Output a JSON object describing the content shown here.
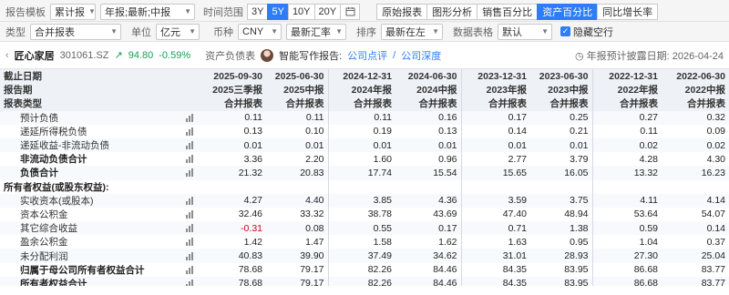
{
  "toolbar1": {
    "report_template_label": "报告模板",
    "template_value": "累计报",
    "period_value": "年报;最新;中报",
    "time_range_label": "时间范围",
    "ranges": [
      "3Y",
      "5Y",
      "10Y",
      "20Y"
    ],
    "active_range": "5Y",
    "tabs": [
      "原始报表",
      "图形分析",
      "销售百分比",
      "资产百分比",
      "同比增长率"
    ],
    "active_tab": "资产百分比"
  },
  "toolbar2": {
    "type_label": "类型",
    "type_value": "合并报表",
    "unit_label": "单位",
    "unit_value": "亿元",
    "currency_label": "币种",
    "currency_value": "CNY",
    "rate_value": "最新汇率",
    "sort_label": "排序",
    "sort_value": "最新在左",
    "data_table_label": "数据表格",
    "data_table_value": "默认",
    "hide_empty_label": "隐藏空行"
  },
  "stock": {
    "name": "匠心家居",
    "code": "301061.SZ",
    "price": "94.80",
    "change": "-0.59%",
    "section": "资产负债表",
    "smart_report_label": "智能写作报告:",
    "link1": "公司点评",
    "link_sep": "/",
    "link2": "公司深度",
    "annual_disclosure": "年报预计披露日期: 2026-04-24"
  },
  "table": {
    "header_rows": [
      [
        "截止日期",
        "2025-09-30",
        "2025-06-30",
        "2024-12-31",
        "2024-06-30",
        "2023-12-31",
        "2023-06-30",
        "2022-12-31",
        "2022-06-30"
      ],
      [
        "报告期",
        "2025三季报",
        "2025中报",
        "2024年报",
        "2024中报",
        "2023年报",
        "2023中报",
        "2022年报",
        "2022中报"
      ],
      [
        "报表类型",
        "合并报表",
        "合并报表",
        "合并报表",
        "合并报表",
        "合并报表",
        "合并报表",
        "合并报表",
        "合并报表"
      ]
    ],
    "rows": [
      {
        "label": "预计负债",
        "indent": true,
        "bold": false,
        "chart": true,
        "values": [
          "0.11",
          "0.11",
          "0.11",
          "0.16",
          "0.17",
          "0.25",
          "0.27",
          "0.32"
        ]
      },
      {
        "label": "递延所得税负债",
        "indent": true,
        "bold": false,
        "chart": true,
        "values": [
          "0.13",
          "0.10",
          "0.19",
          "0.13",
          "0.14",
          "0.21",
          "0.11",
          "0.09"
        ]
      },
      {
        "label": "递延收益-非流动负债",
        "indent": true,
        "bold": false,
        "chart": true,
        "values": [
          "0.01",
          "0.01",
          "0.01",
          "0.01",
          "0.01",
          "0.01",
          "0.02",
          "0.02"
        ]
      },
      {
        "label": "非流动负债合计",
        "indent": true,
        "bold": true,
        "chart": true,
        "values": [
          "3.36",
          "2.20",
          "1.60",
          "0.96",
          "2.77",
          "3.79",
          "4.28",
          "4.30"
        ]
      },
      {
        "label": "负债合计",
        "indent": true,
        "bold": true,
        "chart": true,
        "values": [
          "21.32",
          "20.83",
          "17.74",
          "15.54",
          "15.65",
          "16.05",
          "13.32",
          "16.23"
        ]
      },
      {
        "label": "所有者权益(或股东权益):",
        "indent": false,
        "bold": true,
        "chart": false,
        "values": [
          "",
          "",
          "",
          "",
          "",
          "",
          "",
          ""
        ]
      },
      {
        "label": "实收资本(或股本)",
        "indent": true,
        "bold": false,
        "chart": true,
        "values": [
          "4.27",
          "4.40",
          "3.85",
          "4.36",
          "3.59",
          "3.75",
          "4.11",
          "4.14"
        ]
      },
      {
        "label": "资本公积金",
        "indent": true,
        "bold": false,
        "chart": true,
        "values": [
          "32.46",
          "33.32",
          "38.78",
          "43.69",
          "47.40",
          "48.94",
          "53.64",
          "54.07"
        ]
      },
      {
        "label": "其它综合收益",
        "indent": true,
        "bold": false,
        "chart": true,
        "values": [
          "-0.31",
          "0.08",
          "0.55",
          "0.17",
          "0.71",
          "1.38",
          "0.59",
          "0.14"
        ]
      },
      {
        "label": "盈余公积金",
        "indent": true,
        "bold": false,
        "chart": true,
        "values": [
          "1.42",
          "1.47",
          "1.58",
          "1.62",
          "1.63",
          "0.95",
          "1.04",
          "0.37"
        ]
      },
      {
        "label": "未分配利润",
        "indent": true,
        "bold": false,
        "chart": true,
        "values": [
          "40.83",
          "39.90",
          "37.49",
          "34.62",
          "31.01",
          "28.93",
          "27.30",
          "25.04"
        ]
      },
      {
        "label": "归属于母公司所有者权益合计",
        "indent": true,
        "bold": true,
        "chart": true,
        "values": [
          "78.68",
          "79.17",
          "82.26",
          "84.46",
          "84.35",
          "83.95",
          "86.68",
          "83.77"
        ]
      },
      {
        "label": "所有者权益合计",
        "indent": true,
        "bold": true,
        "chart": true,
        "values": [
          "78.68",
          "79.17",
          "82.26",
          "84.46",
          "84.35",
          "83.95",
          "86.68",
          "83.77"
        ]
      }
    ]
  },
  "colors": {
    "accent": "#2f7df6",
    "positive": "#18a058",
    "negative": "#d0021b"
  }
}
